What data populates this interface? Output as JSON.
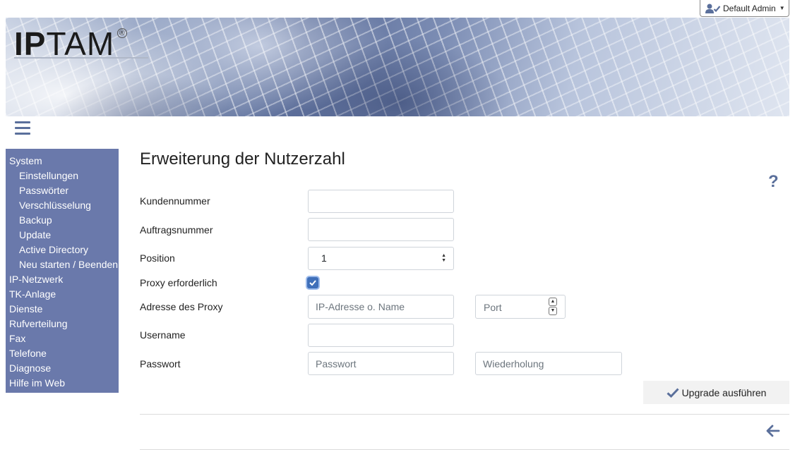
{
  "user_menu": {
    "label": "Default Admin"
  },
  "logo": {
    "ip": "IP",
    "tam": "TAM",
    "reg": "®"
  },
  "sidebar": {
    "items": [
      {
        "label": "System",
        "level": "top"
      },
      {
        "label": "Einstellungen",
        "level": "sub"
      },
      {
        "label": "Passwörter",
        "level": "sub"
      },
      {
        "label": "Verschlüsselung",
        "level": "sub"
      },
      {
        "label": "Backup",
        "level": "sub"
      },
      {
        "label": "Update",
        "level": "sub"
      },
      {
        "label": "Active Directory",
        "level": "sub"
      },
      {
        "label": "Neu starten / Beenden",
        "level": "sub"
      },
      {
        "label": "IP-Netzwerk",
        "level": "top"
      },
      {
        "label": "TK-Anlage",
        "level": "top"
      },
      {
        "label": "Dienste",
        "level": "top"
      },
      {
        "label": "Rufverteilung",
        "level": "top"
      },
      {
        "label": "Fax",
        "level": "top"
      },
      {
        "label": "Telefone",
        "level": "top"
      },
      {
        "label": "Diagnose",
        "level": "top"
      },
      {
        "label": "Hilfe im Web",
        "level": "top"
      }
    ]
  },
  "main": {
    "title": "Erweiterung der Nutzerzahl",
    "help": "?",
    "form": {
      "kundennummer": {
        "label": "Kundennummer",
        "value": ""
      },
      "auftragsnummer": {
        "label": "Auftragsnummer",
        "value": ""
      },
      "position": {
        "label": "Position",
        "value": "1"
      },
      "proxy_required": {
        "label": "Proxy erforderlich",
        "checked": true
      },
      "proxy_address": {
        "label": "Adresse des Proxy",
        "placeholder": "IP-Adresse o. Name",
        "port_placeholder": "Port"
      },
      "username": {
        "label": "Username",
        "value": ""
      },
      "password": {
        "label": "Passwort",
        "placeholder": "Passwort",
        "repeat_placeholder": "Wiederholung"
      }
    },
    "upgrade_button": "Upgrade ausführen"
  },
  "colors": {
    "sidebar_bg": "#6a79ab",
    "accent": "#5a6f9b",
    "checkbox": "#3f6fb9"
  }
}
